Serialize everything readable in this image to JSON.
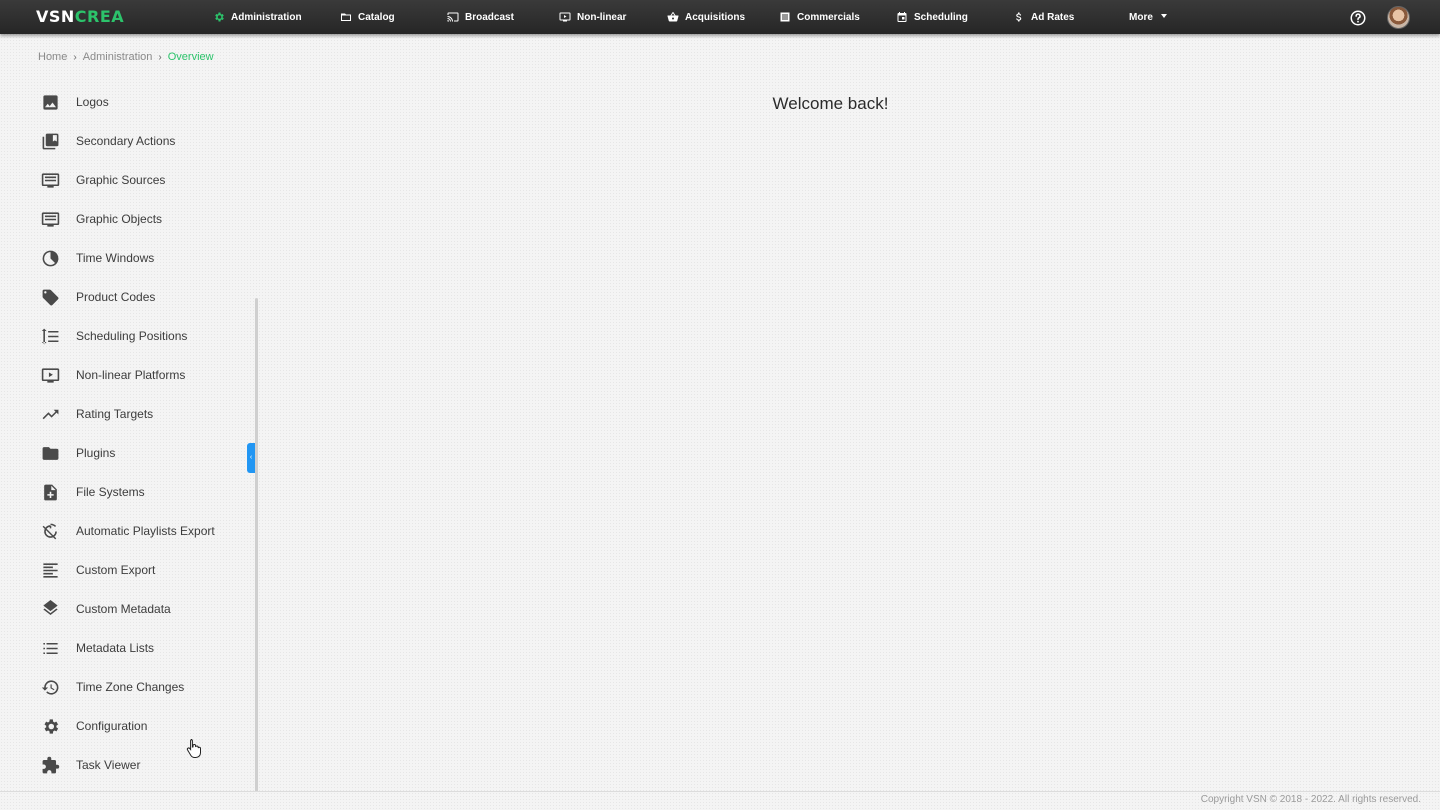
{
  "header": {
    "logo_part1": "VSN",
    "logo_part2": "CREA",
    "nav": [
      {
        "label": "Administration",
        "icon": "gear-icon",
        "active": true
      },
      {
        "label": "Catalog",
        "icon": "folder-icon"
      },
      {
        "label": "Broadcast",
        "icon": "cast-icon"
      },
      {
        "label": "Non-linear",
        "icon": "play-screen-icon"
      },
      {
        "label": "Acquisitions",
        "icon": "basket-icon"
      },
      {
        "label": "Commercials",
        "icon": "list-doc-icon"
      },
      {
        "label": "Scheduling",
        "icon": "calendar-icon"
      },
      {
        "label": "Ad Rates",
        "icon": "dollar-icon"
      },
      {
        "label": "More",
        "icon": "caret-down-icon"
      }
    ],
    "accent_color": "#2cc36b"
  },
  "breadcrumb": {
    "home": "Home",
    "section": "Administration",
    "current": "Overview",
    "separator": "›"
  },
  "sidebar": {
    "items": [
      {
        "label": "Logos",
        "icon": "image-icon"
      },
      {
        "label": "Secondary Actions",
        "icon": "library-icon"
      },
      {
        "label": "Graphic Sources",
        "icon": "monitor-text-icon"
      },
      {
        "label": "Graphic Objects",
        "icon": "monitor-text-icon"
      },
      {
        "label": "Time Windows",
        "icon": "half-circle-icon"
      },
      {
        "label": "Product Codes",
        "icon": "tag-icon"
      },
      {
        "label": "Scheduling Positions",
        "icon": "ordered-list-icon"
      },
      {
        "label": "Non-linear Platforms",
        "icon": "play-screen-icon"
      },
      {
        "label": "Rating Targets",
        "icon": "trending-up-icon"
      },
      {
        "label": "Plugins",
        "icon": "folder-icon"
      },
      {
        "label": "File Systems",
        "icon": "file-add-icon"
      },
      {
        "label": "Automatic Playlists Export",
        "icon": "timer-off-icon"
      },
      {
        "label": "Custom Export",
        "icon": "align-left-icon"
      },
      {
        "label": "Custom Metadata",
        "icon": "layers-icon"
      },
      {
        "label": "Metadata Lists",
        "icon": "list-icon"
      },
      {
        "label": "Time Zone Changes",
        "icon": "history-icon"
      },
      {
        "label": "Configuration",
        "icon": "gear-icon"
      },
      {
        "label": "Task Viewer",
        "icon": "puzzle-icon"
      }
    ],
    "collapse_glyph": "‹",
    "handle_color": "#2196f3"
  },
  "main": {
    "welcome": "Welcome back!"
  },
  "footer": {
    "copyright": "Copyright VSN © 2018 - 2022. All rights reserved."
  }
}
